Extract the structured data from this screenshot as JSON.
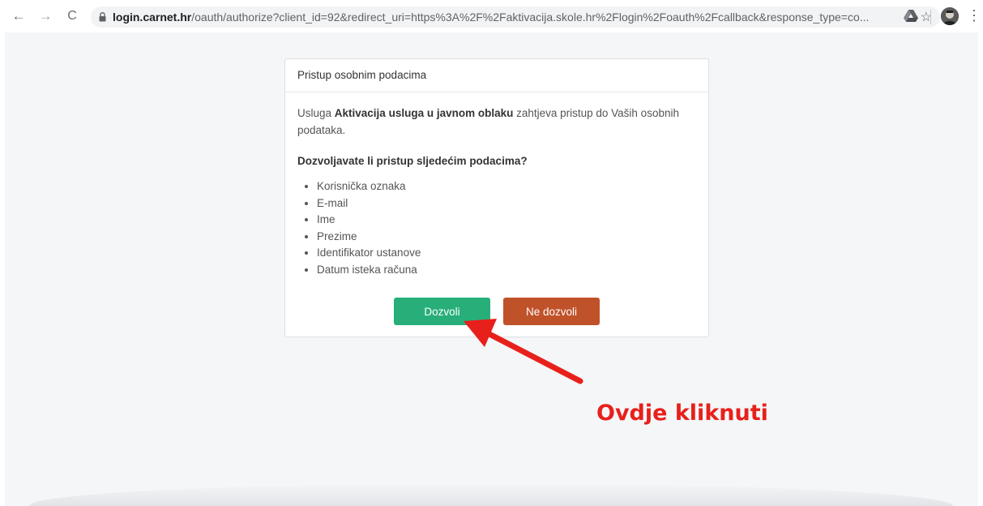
{
  "browser": {
    "url_host": "login.carnet.hr",
    "url_rest": "/oauth/authorize?client_id=92&redirect_uri=https%3A%2F%2Faktivacija.skole.hr%2Flogin%2Foauth%2Fcallback&response_type=co...",
    "icons": [
      "back-arrow-icon",
      "forward-arrow-icon",
      "reload-icon",
      "lock-icon",
      "star-icon",
      "drive-extension-icon",
      "avatar",
      "more-vert-icon"
    ]
  },
  "card": {
    "header": "Pristup osobnim podacima",
    "intro_prefix": "Usluga ",
    "intro_service": "Aktivacija usluga u javnom oblaku",
    "intro_suffix": " zahtjeva pristup do Vaših osobnih podataka.",
    "question": "Dozvoljavate li pristup sljedećim podacima?",
    "fields": [
      "Korisnička oznaka",
      "E-mail",
      "Ime",
      "Prezime",
      "Identifikator ustanove",
      "Datum isteka računa"
    ],
    "allow_label": "Dozvoli",
    "deny_label": "Ne dozvoli"
  },
  "annotation": {
    "text": "Ovdje kliknuti",
    "color": "#e8201b"
  },
  "colors": {
    "allow": "#27ae79",
    "deny": "#c0522a",
    "page_bg": "#f4f6f8"
  }
}
